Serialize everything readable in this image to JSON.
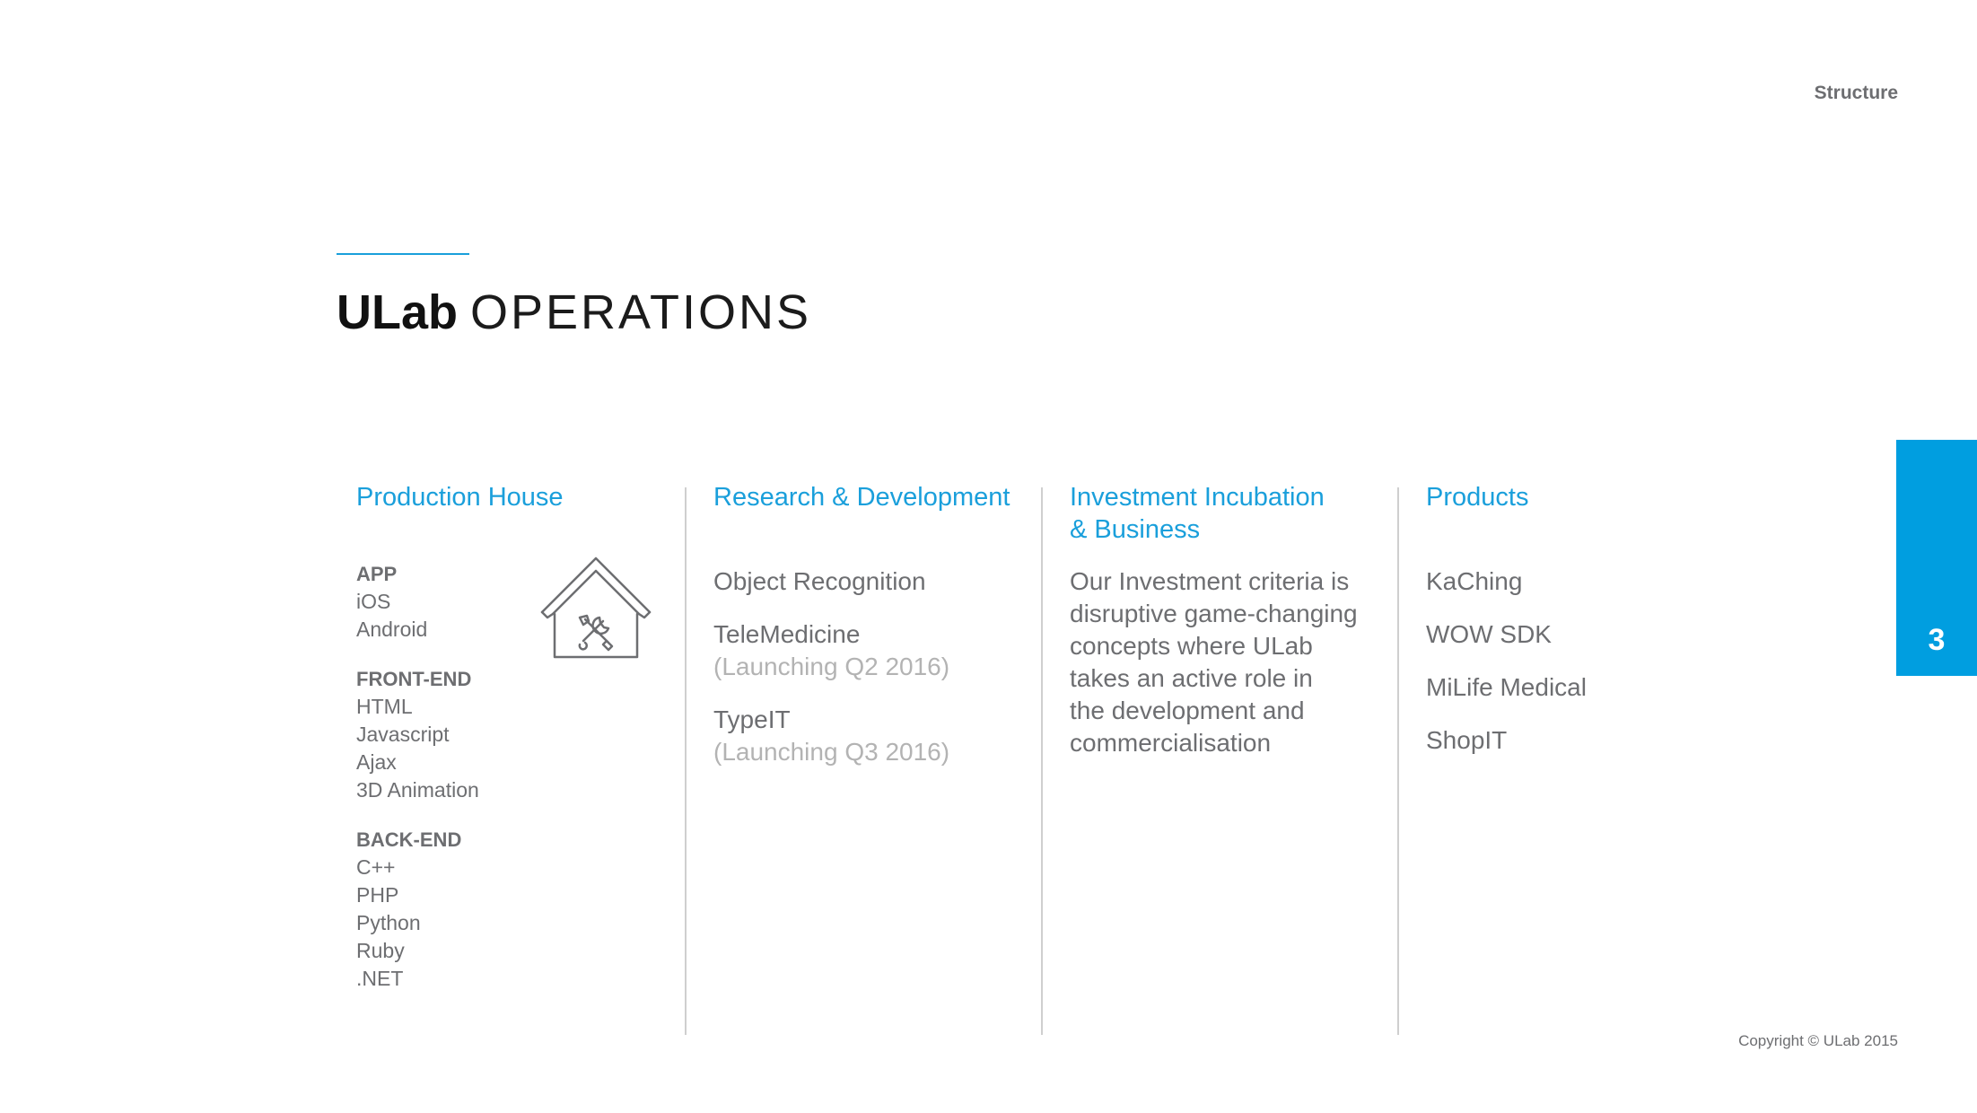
{
  "header": {
    "section_label": "Structure"
  },
  "title": {
    "strong": "ULab",
    "light": "OPERATIONS"
  },
  "columns": {
    "production": {
      "heading": "Production House",
      "groups": [
        {
          "title": "APP",
          "items": [
            "iOS",
            "Android"
          ]
        },
        {
          "title": "FRONT-END",
          "items": [
            "HTML",
            "Javascript",
            "Ajax",
            "3D Animation"
          ]
        },
        {
          "title": "BACK-END",
          "items": [
            "C++",
            "PHP",
            "Python",
            "Ruby",
            ".NET"
          ]
        }
      ]
    },
    "research": {
      "heading": "Research & Development",
      "entries": [
        {
          "title": "Object Recognition",
          "sub": ""
        },
        {
          "title": "TeleMedicine",
          "sub": "(Launching Q2 2016)"
        },
        {
          "title": "TypeIT",
          "sub": "(Launching Q3 2016)"
        }
      ]
    },
    "investment": {
      "heading": "Investment Incubation\n& Business",
      "lines": [
        "Our Investment criteria is",
        "disruptive game-changing",
        "concepts where ULab",
        "takes an active role in",
        "the development and",
        "commercialisation"
      ]
    },
    "products": {
      "heading": "Products",
      "items": [
        "KaChing",
        "WOW SDK",
        "MiLife Medical",
        "ShopIT"
      ]
    }
  },
  "page_number": "3",
  "footer": {
    "copyright": "Copyright © ULab 2015"
  },
  "colors": {
    "accent": "#1a9fdb",
    "tab": "#009ee0",
    "text": "#6d6e71",
    "muted": "#b3b3b3"
  },
  "icons": {
    "production": "house-tools-icon"
  }
}
